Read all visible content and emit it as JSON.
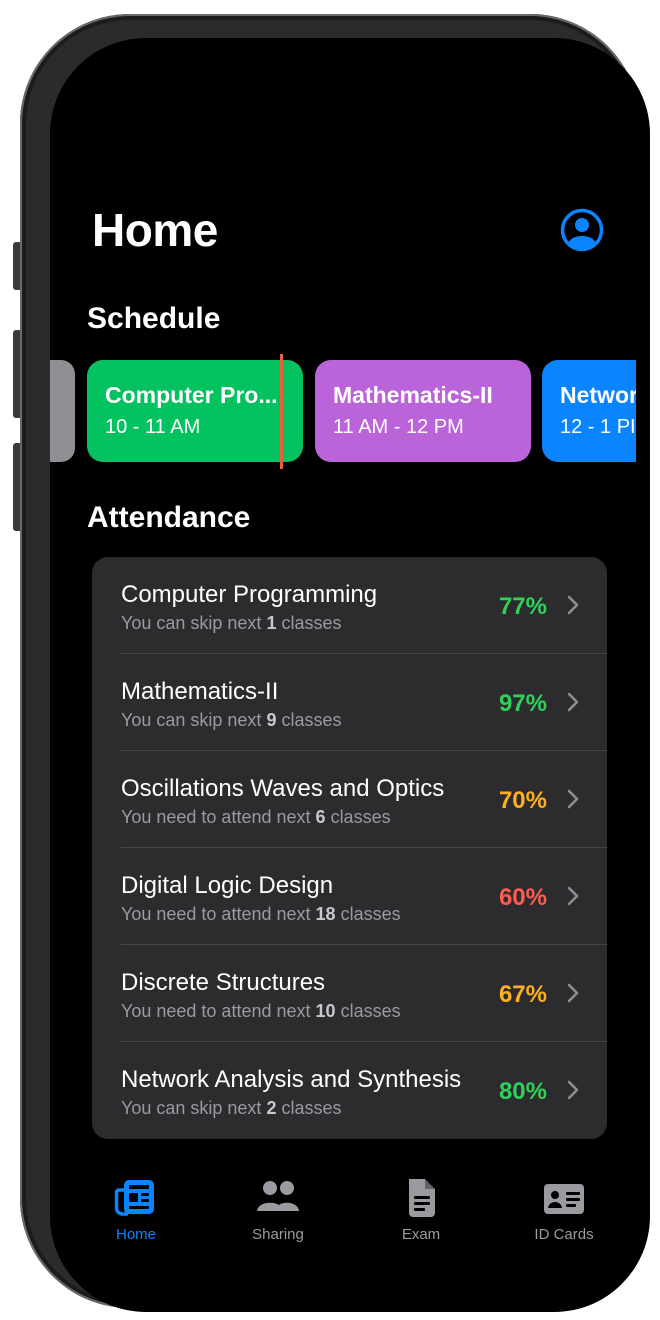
{
  "header": {
    "title": "Home",
    "profile_icon": "person-circle-icon"
  },
  "schedule": {
    "title": "Schedule",
    "cards": [
      {
        "title": "Computer Pro...",
        "time": "10 - 11 AM",
        "color": "#04c25f"
      },
      {
        "title": "Mathematics-II",
        "time": "11 AM - 12 PM",
        "color": "#bb63d9"
      },
      {
        "title": "Networ",
        "time": "12 - 1 PI",
        "color": "#0a84ff"
      }
    ],
    "now_indicator_color": "#e8603c"
  },
  "attendance": {
    "title": "Attendance",
    "rows": [
      {
        "name": "Computer Programming",
        "prefix": "You can skip next",
        "count": "1",
        "suffix": "classes",
        "percent": "77%",
        "color": "#30d158"
      },
      {
        "name": "Mathematics-II",
        "prefix": "You can skip next",
        "count": "9",
        "suffix": "classes",
        "percent": "97%",
        "color": "#30d158"
      },
      {
        "name": "Oscillations Waves and Optics",
        "prefix": "You need to attend next",
        "count": "6",
        "suffix": "classes",
        "percent": "70%",
        "color": "#ffb020"
      },
      {
        "name": "Digital Logic Design",
        "prefix": "You need to attend next",
        "count": "18",
        "suffix": "classes",
        "percent": "60%",
        "color": "#ff5b4f"
      },
      {
        "name": "Discrete Structures",
        "prefix": "You need to attend next",
        "count": "10",
        "suffix": "classes",
        "percent": "67%",
        "color": "#ffb020"
      },
      {
        "name": "Network Analysis and Synthesis",
        "prefix": "You can skip next",
        "count": "2",
        "suffix": "classes",
        "percent": "80%",
        "color": "#30d158"
      }
    ]
  },
  "tabs": [
    {
      "label": "Home",
      "icon": "newspaper-icon",
      "active": true
    },
    {
      "label": "Sharing",
      "icon": "people-icon",
      "active": false
    },
    {
      "label": "Exam",
      "icon": "document-icon",
      "active": false
    },
    {
      "label": "ID Cards",
      "icon": "id-card-icon",
      "active": false
    }
  ],
  "colors": {
    "accent": "#0a84ff",
    "inactive_tab": "#9a9aa0",
    "card_bg": "#2c2c2e"
  }
}
